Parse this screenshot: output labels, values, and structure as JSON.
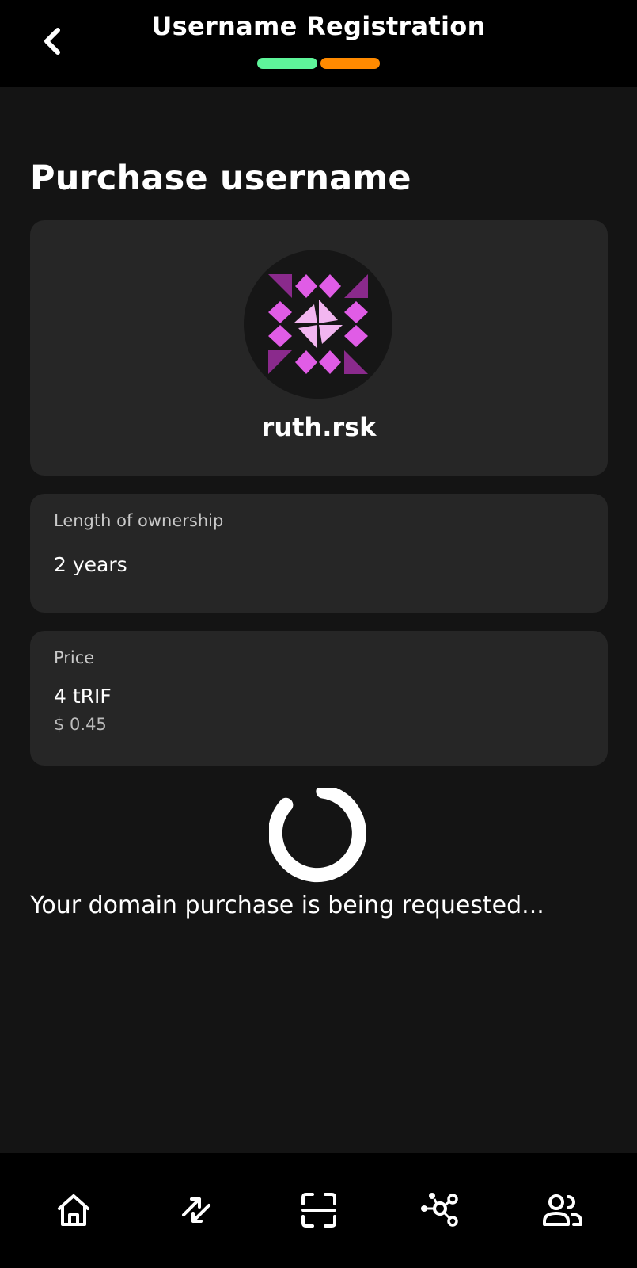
{
  "header": {
    "title": "Username Registration",
    "back_icon": "chevron-left-icon",
    "progress": {
      "steps_total": 2,
      "steps_done": 1,
      "done_color": "#5ef59a",
      "current_color": "#ff8a00"
    }
  },
  "main": {
    "title": "Purchase username",
    "username_card": {
      "avatar_icon": "identicon-avatar",
      "domain": "ruth.rsk"
    },
    "ownership": {
      "label": "Length of ownership",
      "value": "2 years"
    },
    "price": {
      "label": "Price",
      "value": "4 tRIF",
      "usd": "$ 0.45"
    },
    "status": "Your domain purchase is being requested..."
  },
  "bottom_nav": {
    "items": [
      {
        "icon": "home-icon"
      },
      {
        "icon": "send-receive-icon"
      },
      {
        "icon": "scan-icon"
      },
      {
        "icon": "dapps-icon"
      },
      {
        "icon": "contacts-icon"
      }
    ]
  },
  "colors": {
    "background": "#141414",
    "header": "#000000",
    "card": "#262626",
    "identicon": "#e05ce6"
  }
}
